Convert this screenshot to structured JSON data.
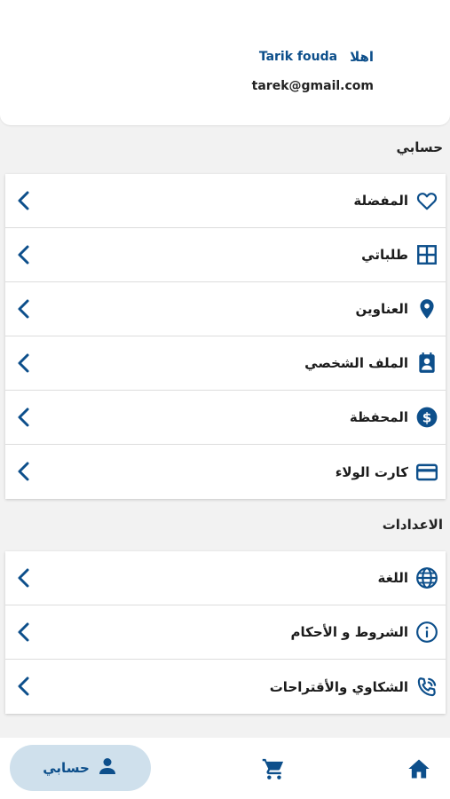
{
  "profile": {
    "greeting": "اهلا",
    "name": "Tarik fouda",
    "email": "tarek@gmail.com"
  },
  "account_section": {
    "title": "حسابي",
    "items": [
      {
        "label": "المفضلة",
        "icon": "heart-icon"
      },
      {
        "label": "طلباتي",
        "icon": "grid-icon"
      },
      {
        "label": "العناوين",
        "icon": "location-pin-icon"
      },
      {
        "label": "الملف الشخصي",
        "icon": "contact-card-icon"
      },
      {
        "label": "المحفظة",
        "icon": "dollar-circle-icon"
      },
      {
        "label": "كارت الولاء",
        "icon": "credit-card-icon"
      }
    ]
  },
  "settings_section": {
    "title": "الاعدادات",
    "items": [
      {
        "label": "اللغة",
        "icon": "globe-icon"
      },
      {
        "label": "الشروط و الأحكام",
        "icon": "info-icon"
      },
      {
        "label": "الشكاوي والأقتراحات",
        "icon": "phone-call-icon"
      }
    ]
  },
  "bottom_nav": {
    "account_label": "حسابي",
    "active_tab": "account"
  },
  "colors": {
    "brand": "#0d4f8b",
    "active_pill": "#cfe0ec",
    "background": "#f2f2f2"
  }
}
